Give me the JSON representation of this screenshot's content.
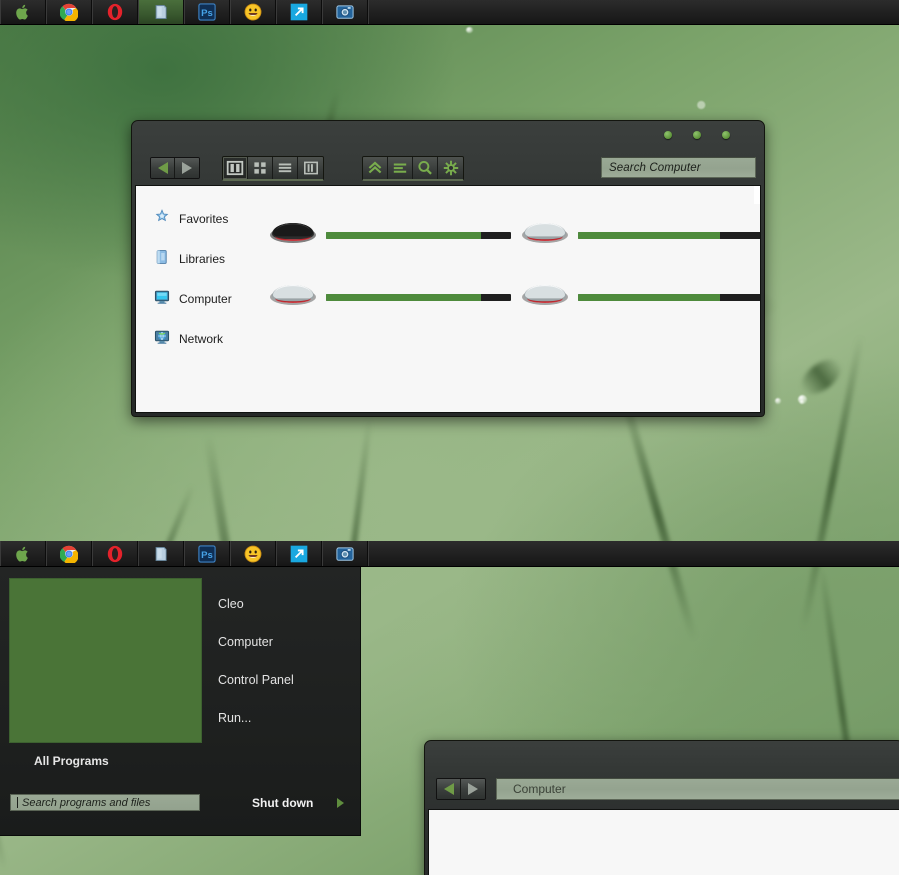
{
  "desktop": {
    "wallpaper_desc": "blurred green grass with dew drops",
    "accent_green": "#5d9338",
    "taskbar_bg": "#222222"
  },
  "taskbar_top": {
    "items": [
      {
        "name": "apple-icon",
        "label": "Apple",
        "active": false
      },
      {
        "name": "chrome-icon",
        "label": "Google Chrome",
        "active": false
      },
      {
        "name": "opera-icon",
        "label": "Opera",
        "active": false
      },
      {
        "name": "explorer-icon",
        "label": "Windows Explorer",
        "active": true
      },
      {
        "name": "photoshop-icon",
        "label": "Ps",
        "active": false
      },
      {
        "name": "smiley-icon",
        "label": "Messenger",
        "active": false
      },
      {
        "name": "arrow-launch-icon",
        "label": "Launcher",
        "active": false
      },
      {
        "name": "camera-icon",
        "label": "Screen Capture",
        "active": false
      }
    ]
  },
  "taskbar_second": {
    "items": [
      {
        "name": "apple-icon",
        "label": "Apple",
        "active": false
      },
      {
        "name": "chrome-icon",
        "label": "Google Chrome",
        "active": false
      },
      {
        "name": "opera-icon",
        "label": "Opera",
        "active": false
      },
      {
        "name": "explorer-icon",
        "label": "Windows Explorer",
        "active": false
      },
      {
        "name": "photoshop-icon",
        "label": "Ps",
        "active": false
      },
      {
        "name": "smiley-icon",
        "label": "Messenger",
        "active": false
      },
      {
        "name": "arrow-launch-icon",
        "label": "Launcher",
        "active": false
      },
      {
        "name": "camera-icon",
        "label": "Screen Capture",
        "active": false
      }
    ]
  },
  "explorer": {
    "window_controls": [
      "minimize-dot",
      "maximize-dot",
      "close-dot"
    ],
    "nav": {
      "back": "Back",
      "forward": "Forward"
    },
    "view_buttons": [
      {
        "name": "view-pane-button",
        "label": "Preview pane",
        "selected": true
      },
      {
        "name": "view-icons-button",
        "label": "Icons",
        "selected": false
      },
      {
        "name": "view-list-button",
        "label": "List",
        "selected": false
      },
      {
        "name": "view-columns-button",
        "label": "Columns",
        "selected": false
      }
    ],
    "action_buttons": [
      {
        "name": "up-button",
        "label": "Up"
      },
      {
        "name": "sort-button",
        "label": "Sort"
      },
      {
        "name": "search-button",
        "label": "Search"
      },
      {
        "name": "settings-button",
        "label": "Settings"
      }
    ],
    "search": {
      "placeholder": "Search Computer",
      "value": ""
    },
    "sidebar": [
      {
        "name": "sidebar-item-favorites",
        "label": "Favorites",
        "icon": "favorites-star-icon"
      },
      {
        "name": "sidebar-item-libraries",
        "label": "Libraries",
        "icon": "libraries-book-icon"
      },
      {
        "name": "sidebar-item-computer",
        "label": "Computer",
        "icon": "computer-monitor-icon"
      },
      {
        "name": "sidebar-item-network",
        "label": "Network",
        "icon": "network-globe-icon"
      }
    ],
    "drives": [
      {
        "name": "drive-item",
        "icon": "hard-drive-black-icon",
        "fill_percent": 84,
        "color": "#4e8b3c"
      },
      {
        "name": "drive-item",
        "icon": "hard-drive-silver-icon",
        "fill_percent": 77,
        "color": "#4e8b3c"
      },
      {
        "name": "drive-item",
        "icon": "hard-drive-silver-icon",
        "fill_percent": 84,
        "color": "#4e8b3c"
      },
      {
        "name": "drive-item",
        "icon": "hard-drive-silver-icon",
        "fill_percent": 77,
        "color": "#4e8b3c"
      }
    ]
  },
  "start_menu": {
    "all_programs_label": "All Programs",
    "search": {
      "placeholder": "Search programs and files",
      "value": ""
    },
    "items": [
      {
        "name": "start-item-cleo",
        "label": "Cleo"
      },
      {
        "name": "start-item-computer",
        "label": "Computer"
      },
      {
        "name": "start-item-control-panel",
        "label": "Control Panel"
      },
      {
        "name": "start-item-run",
        "label": "Run..."
      }
    ],
    "shutdown_label": "Shut down"
  },
  "explorer2": {
    "nav": {
      "back": "Back",
      "forward": "Forward"
    },
    "address_value": "Computer"
  }
}
